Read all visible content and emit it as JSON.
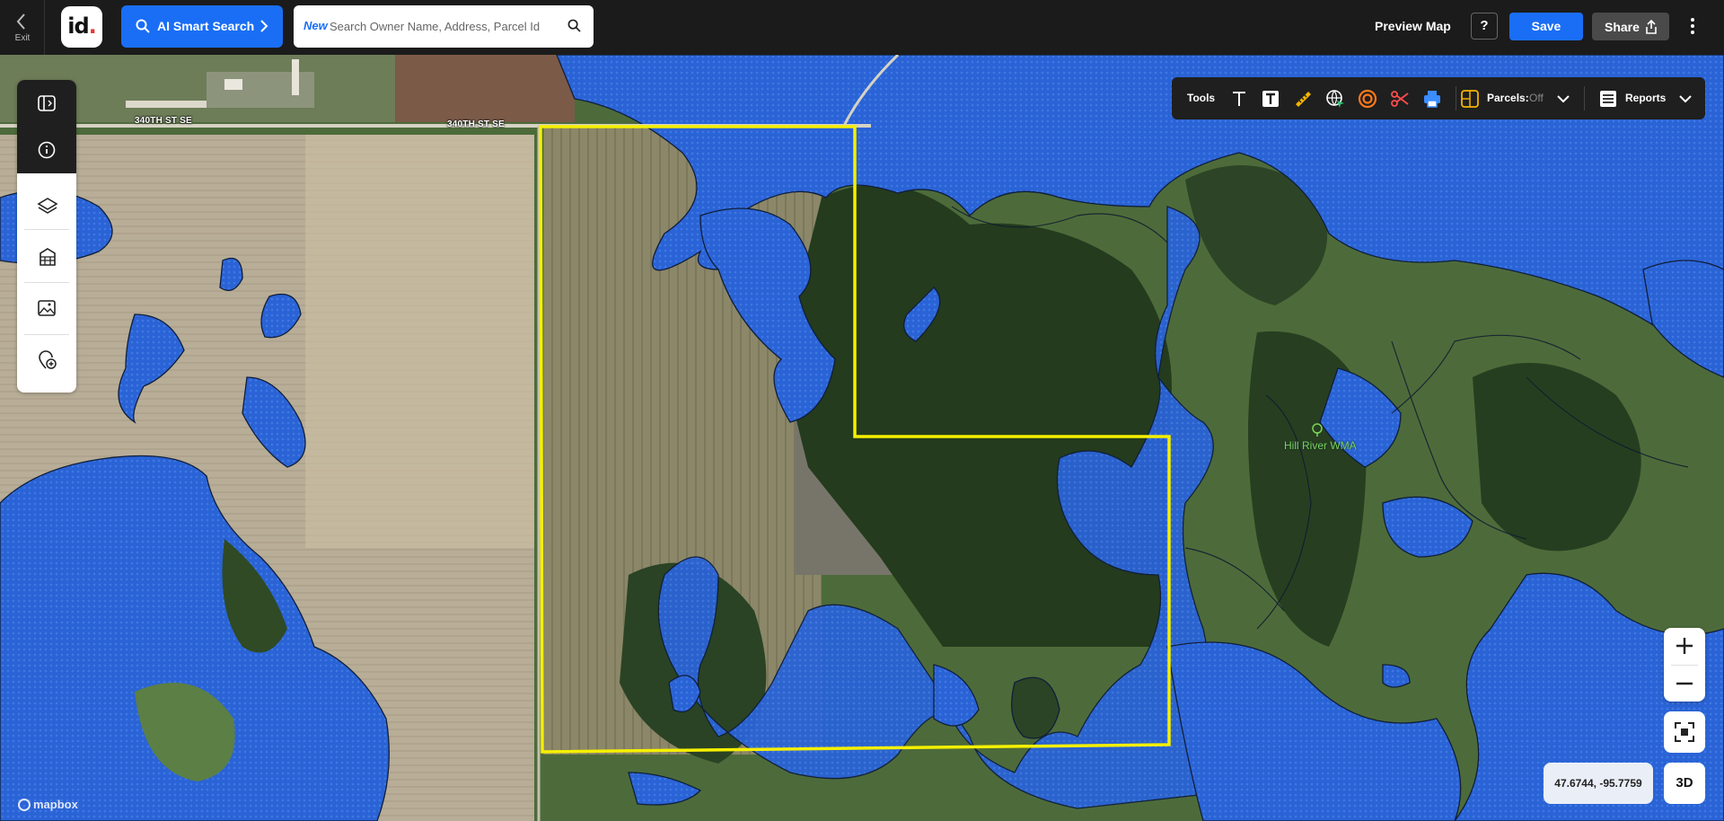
{
  "header": {
    "exit_label": "Exit",
    "logo_text": "id",
    "logo_dot": ".",
    "ai_search_label": "AI Smart Search",
    "search_badge": "New",
    "search_placeholder": "Search Owner Name, Address, Parcel Id",
    "preview_label": "Preview Map",
    "help_label": "?",
    "save_label": "Save",
    "share_label": "Share"
  },
  "toolbar": {
    "tools_label": "Tools",
    "parcels_label": "Parcels:",
    "parcels_state": "Off",
    "reports_label": "Reports",
    "icons": [
      "text-icon",
      "text-box-icon",
      "ruler-icon",
      "globe-cursor-icon",
      "buffer-ring-icon",
      "scissors-icon",
      "print-icon",
      "parcels-icon",
      "reports-icon"
    ]
  },
  "left_panel": {
    "buttons": [
      "collapse-panel-icon",
      "info-icon",
      "layers-icon",
      "buildings-icon",
      "image-icon",
      "add-location-icon"
    ]
  },
  "map": {
    "road_labels": [
      "340TH ST SE",
      "340TH ST SE"
    ],
    "poi_label": "Hill River WMA",
    "attribution": "mapbox",
    "coordinates": "47.6744, -95.7759",
    "view_mode_label": "3D"
  },
  "colors": {
    "accent": "#1a6ef5",
    "topbar": "#1b1b1b",
    "wetland": "#2a63d6",
    "parcel_outline": "#f5f000"
  }
}
